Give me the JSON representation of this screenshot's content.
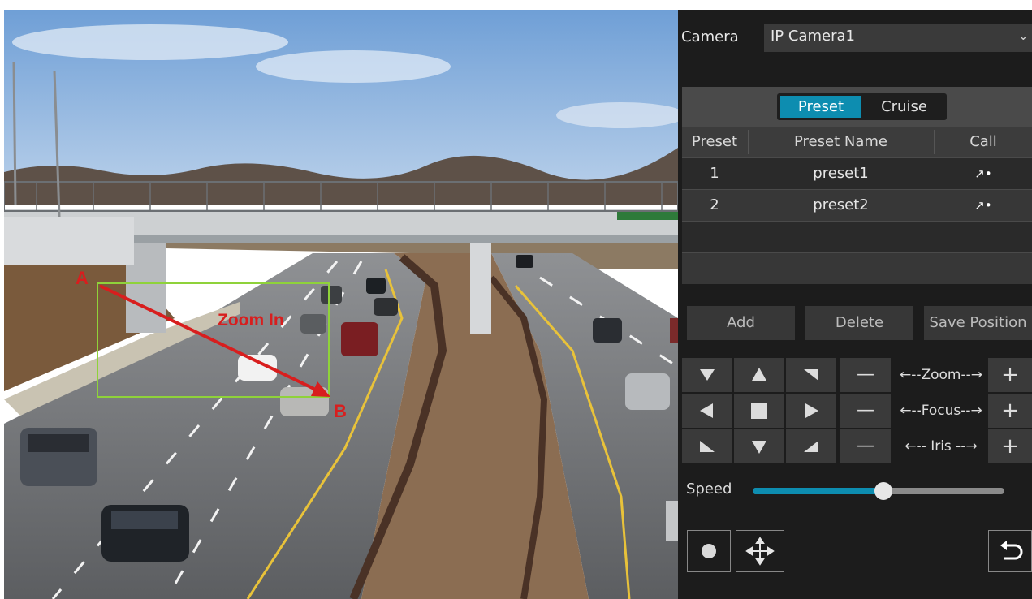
{
  "video": {
    "annotation_a": "A",
    "annotation_b": "B",
    "annotation_zoom": "Zoom In"
  },
  "camera": {
    "label": "Camera",
    "selected": "IP Camera1"
  },
  "tabs": {
    "preset": "Preset",
    "cruise": "Cruise"
  },
  "table": {
    "headers": [
      "Preset",
      "Preset Name",
      "Call"
    ],
    "rows": [
      {
        "num": "1",
        "name": "preset1"
      },
      {
        "num": "2",
        "name": "preset2"
      }
    ]
  },
  "actions": {
    "add": "Add",
    "delete": "Delete",
    "save_position": "Save Position"
  },
  "lens": {
    "zoom": "←--Zoom--→",
    "focus": "←--Focus--→",
    "iris": "←-- Iris --→",
    "minus": "—",
    "plus": "+"
  },
  "speed": {
    "label": "Speed",
    "value_fraction": 0.52
  },
  "colors": {
    "accent": "#0d8db0",
    "annotation": "#d81e1e",
    "zoom_box": "#8fd23a"
  }
}
